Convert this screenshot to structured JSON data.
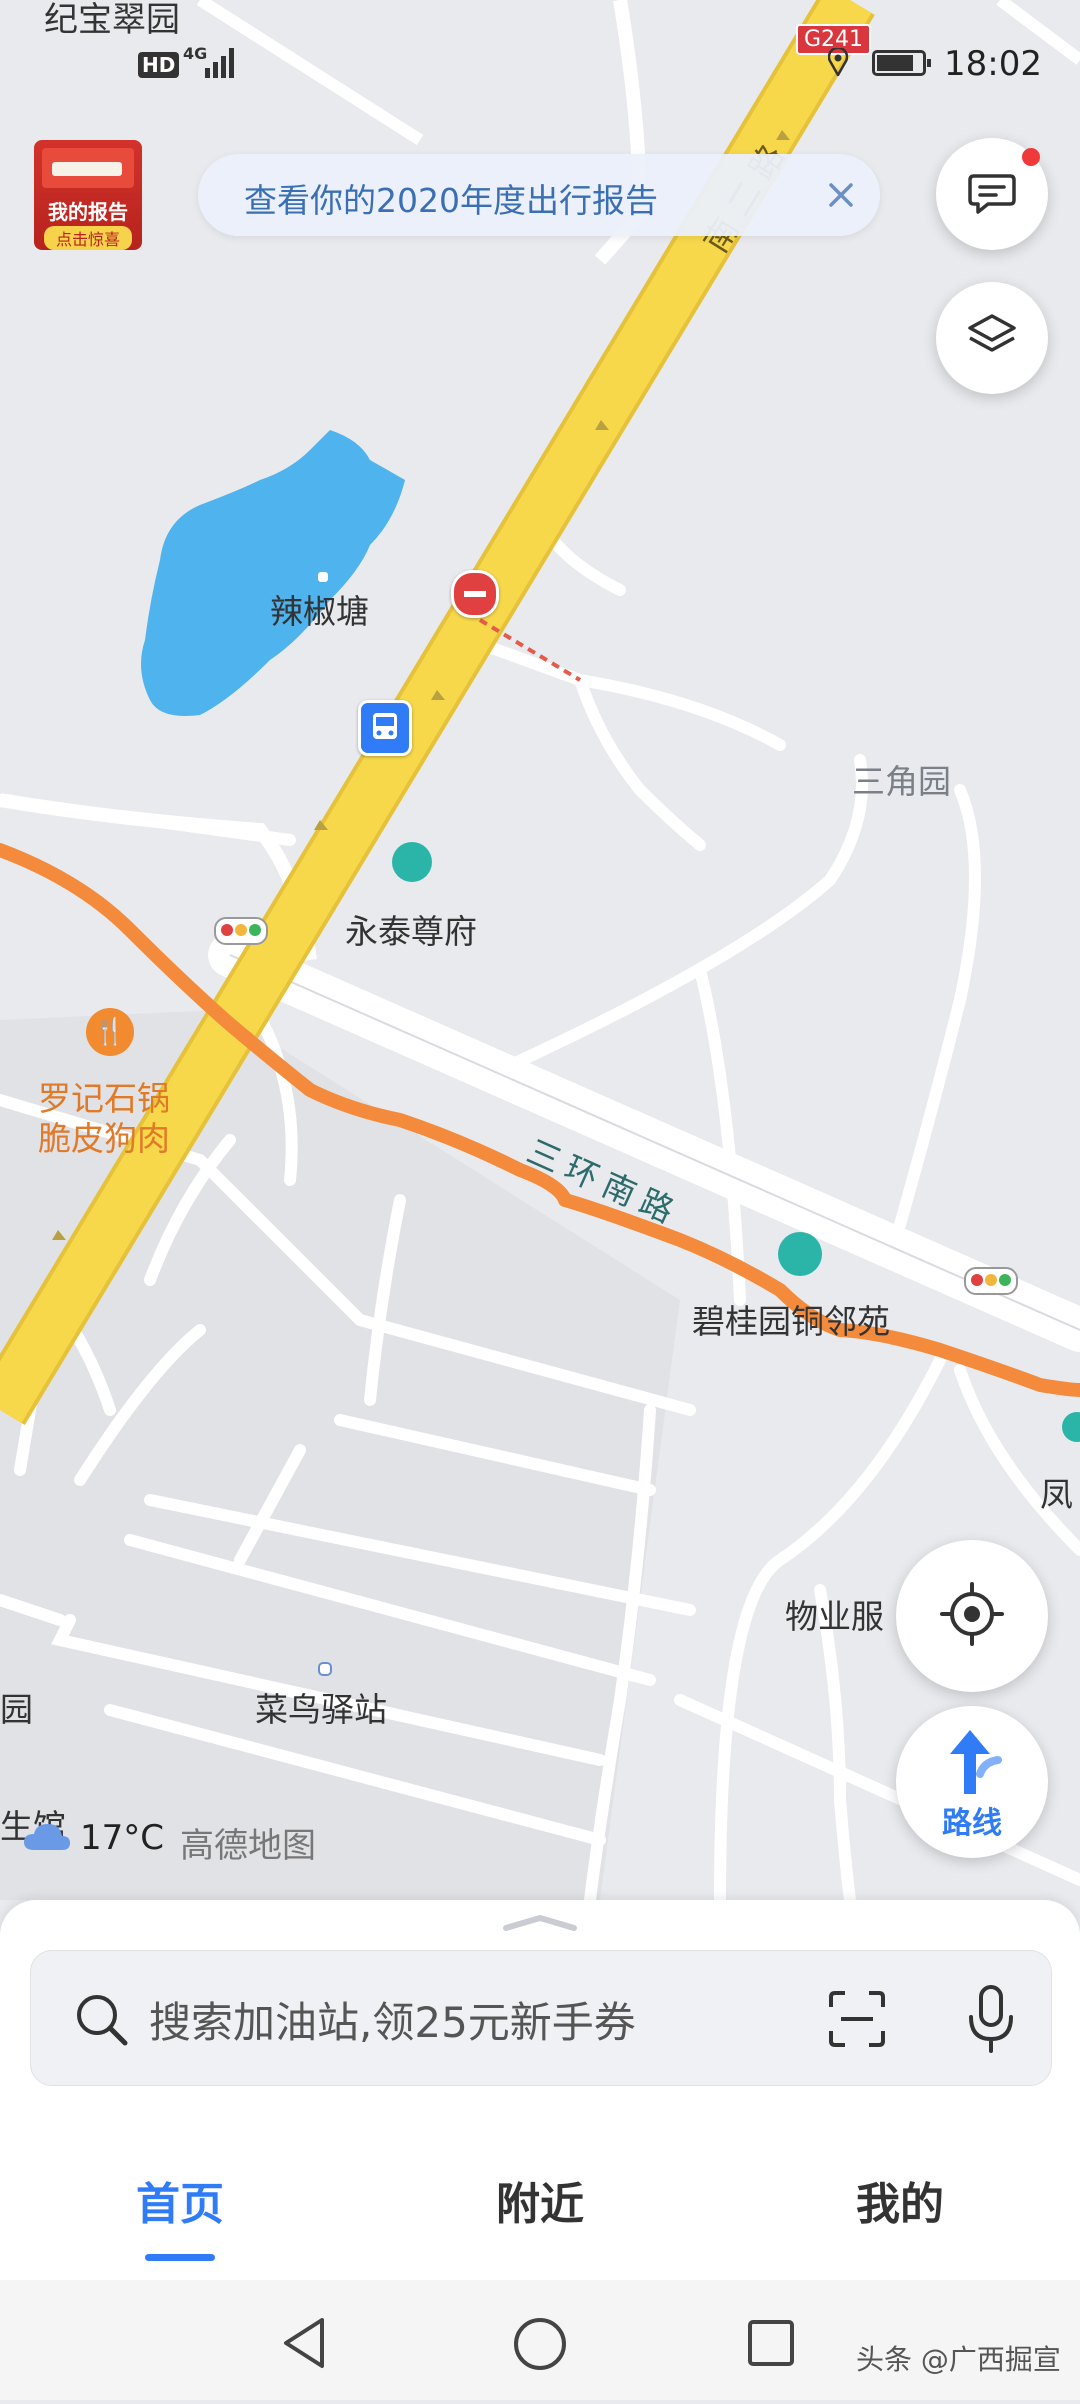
{
  "status_bar": {
    "time": "18:02",
    "network_hd": "HD",
    "network_gen": "4G",
    "road_badge": "G241",
    "top_left_place": "纪宝翠园"
  },
  "banner": {
    "text": "查看你的2020年度出行报告"
  },
  "report_badge": {
    "title": "我的报告",
    "subtitle": "点击惊喜"
  },
  "map": {
    "poi": {
      "lake": "辣椒塘",
      "sanjiaoyuan": "三角园",
      "yongtai": "永泰尊府",
      "restaurant_line1": "罗记石锅",
      "restaurant_line2": "脆皮狗肉",
      "sanhuan_road": "三环南路",
      "biguiyuan": "碧桂园铜邻苑",
      "feng": "凤",
      "wuye": "物业服",
      "cainiao": "菜鸟驿站",
      "nan_er_road": "南二路",
      "left_edge_1": "园",
      "left_edge_2": "生馆"
    },
    "weather": {
      "temperature": "17°C",
      "brand": "高德地图"
    },
    "colors": {
      "route": "#f48b3c",
      "main_road": "#f7d84b",
      "lake": "#4fb3ee",
      "accent": "#2f7cf6"
    }
  },
  "controls": {
    "route_label": "路线"
  },
  "search": {
    "placeholder": "搜索加油站,领25元新手券"
  },
  "tabs": [
    {
      "label": "首页",
      "active": true
    },
    {
      "label": "附近",
      "active": false
    },
    {
      "label": "我的",
      "active": false
    }
  ],
  "watermark": "头条 @广西掘宣"
}
